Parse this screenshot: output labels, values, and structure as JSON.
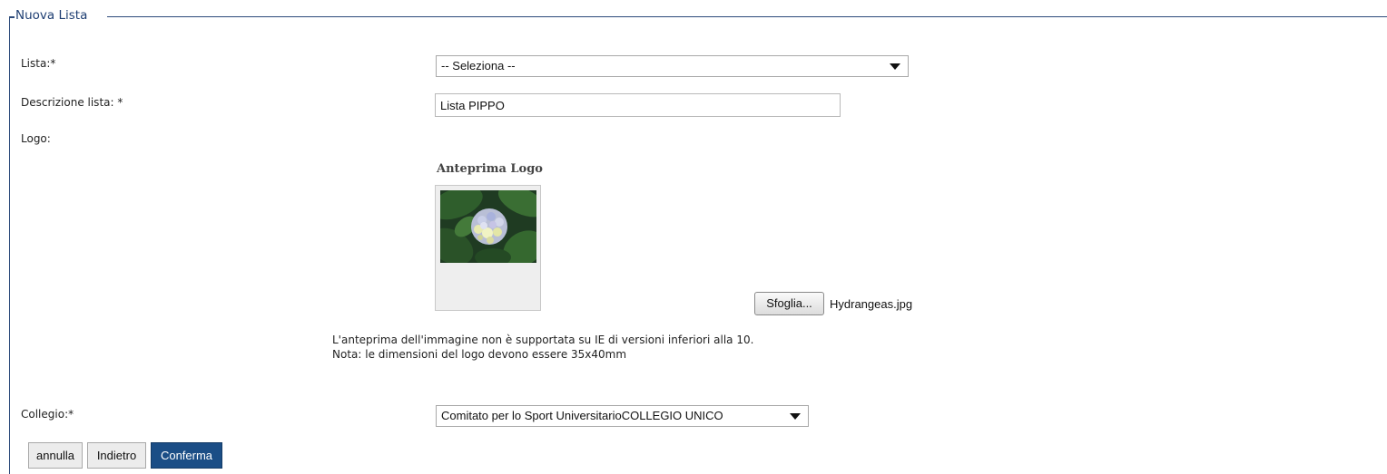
{
  "fieldset": {
    "legend": "Nuova Lista"
  },
  "form": {
    "lista": {
      "label": "Lista:*",
      "selected": "-- Seleziona --"
    },
    "descrizione": {
      "label": "Descrizione lista: *",
      "value": "Lista PIPPO"
    },
    "logo": {
      "label": "Logo:",
      "preview_title": "Anteprima Logo",
      "browse_label": "Sfoglia...",
      "file_name": "Hydrangeas.jpg",
      "note_line1": "L'anteprima dell'immagine non è supportata su IE di versioni inferiori alla 10.",
      "note_line2": "Nota: le dimensioni del logo devono essere 35x40mm"
    },
    "collegio": {
      "label": "Collegio:*",
      "selected": "Comitato per lo Sport UniversitarioCOLLEGIO UNICO"
    }
  },
  "buttons": {
    "annulla": "annulla",
    "indietro": "Indietro",
    "conferma": "Conferma"
  },
  "colors": {
    "legend": "#1f3f73",
    "border": "#2c4a7a",
    "primary_button": "#1b4e86"
  }
}
